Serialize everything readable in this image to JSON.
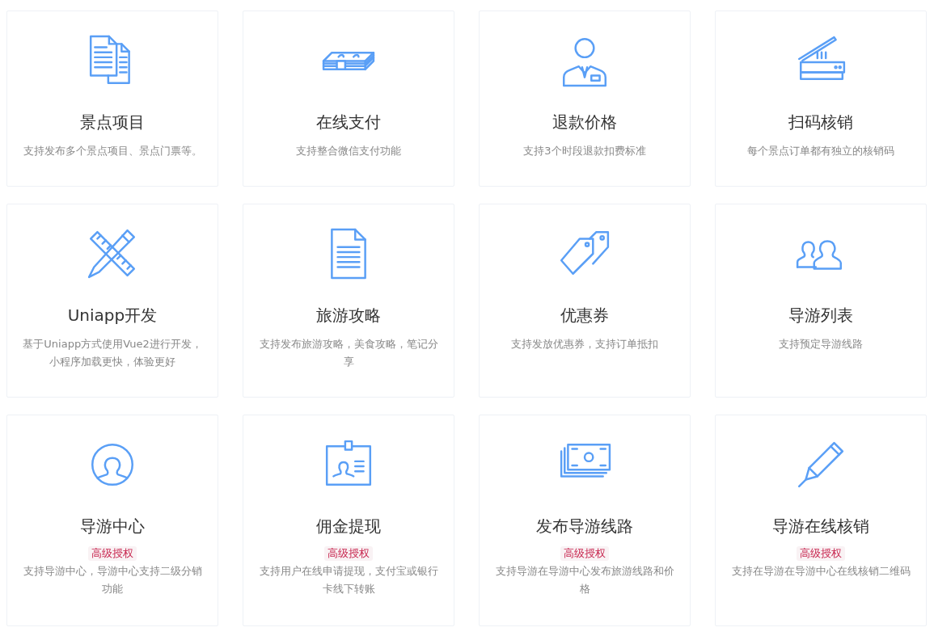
{
  "features": [
    {
      "title": "景点项目",
      "description": "支持发布多个景点项目、景点门票等。"
    },
    {
      "title": "在线支付",
      "description": "支持整合微信支付功能"
    },
    {
      "title": "退款价格",
      "description": "支持3个时段退款扣费标准"
    },
    {
      "title": "扫码核销",
      "description": "每个景点订单都有独立的核销码"
    },
    {
      "title": "Uniapp开发",
      "description": "基于Uniapp方式使用Vue2进行开发，小程序加载更快，体验更好"
    },
    {
      "title": "旅游攻略",
      "description": "支持发布旅游攻略，美食攻略，笔记分享"
    },
    {
      "title": "优惠券",
      "description": "支持发放优惠券，支持订单抵扣"
    },
    {
      "title": "导游列表",
      "description": "支持预定导游线路"
    },
    {
      "title": "导游中心",
      "badge": "高级授权",
      "description": "支持导游中心，导游中心支持二级分销功能"
    },
    {
      "title": "佣金提现",
      "badge": "高级授权",
      "description": "支持用户在线申请提现，支付宝或银行卡线下转账"
    },
    {
      "title": "发布导游线路",
      "badge": "高级授权",
      "description": "支持导游在导游中心发布旅游线路和价格"
    },
    {
      "title": "导游在线核销",
      "badge": "高级授权",
      "description": "支持在导游在导游中心在线核销二维码"
    }
  ]
}
